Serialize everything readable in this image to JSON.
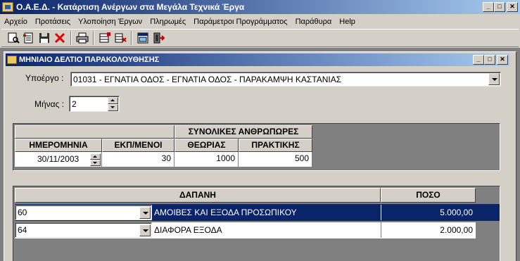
{
  "window": {
    "title": "Ο.Α.Ε.Δ. - Κατάρτιση Ανέργων στα Μεγάλα Τεχνικά Έργα"
  },
  "menu": [
    "Αρχείο",
    "Προτάσεις",
    "Υλοποίηση Έργων",
    "Πληρωμές",
    "Παράμετροι Προγράμματος",
    "Παράθυρα",
    "Help"
  ],
  "toolbar": {
    "icons": [
      "search-doc-icon",
      "new-record-icon",
      "save-icon",
      "delete-icon",
      "print-icon",
      "insert-row-icon",
      "delete-row-icon",
      "form-icon",
      "exit-icon"
    ]
  },
  "child": {
    "title": "ΜΗΝΙΑΙΟ ΔΕΛΤΙΟ ΠΑΡΑΚΟΛΟΥΘΗΣΗΣ",
    "subproject_label": "Υποέργο :",
    "subproject_value": "01031 - ΕΓΝΑΤΙΑ ΟΔΟΣ - ΕΓΝΑΤΙΑ ΟΔΟΣ - ΠΑΡΑΚΑΜΨΗ ΚΑΣΤΑΝΙΑΣ",
    "month_label": "Μήνας :",
    "month_value": "2"
  },
  "grid1": {
    "group_header": "ΣΥΝΟΛΙΚΕΣ ΑΝΘΡΩΠΩΡΕΣ",
    "headers": [
      "ΗΜΕΡΟΜΗΝΙΑ",
      "ΕΚΠ/ΜΕΝΟΙ",
      "ΘΕΩΡΙΑΣ",
      "ΠΡΑΚΤΙΚΗΣ"
    ],
    "row": {
      "date": "30/11/2003",
      "trainees": "30",
      "theory": "1000",
      "practice": "500"
    }
  },
  "grid2": {
    "headers": [
      "ΔΑΠΑΝΗ",
      "ΠΟΣΟ"
    ],
    "rows": [
      {
        "code": "60",
        "desc": "ΑΜΟΙΒΕΣ ΚΑΙ ΕΞΟΔΑ ΠΡΟΣΩΠΙΚΟΥ",
        "amount": "5.000,00"
      },
      {
        "code": "64",
        "desc": "ΔΙΑΦΟΡΑ ΕΞΟΔΑ",
        "amount": "2.000,00"
      }
    ]
  },
  "colors": {
    "titlebar": "#0a246a",
    "face": "#d4d0c8",
    "selection": "#0a246a"
  }
}
